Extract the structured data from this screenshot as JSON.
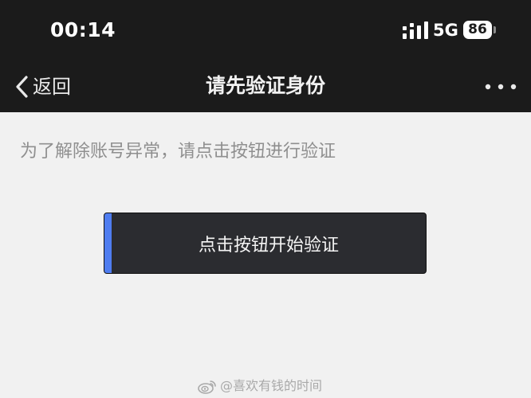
{
  "status_bar": {
    "time": "00:14",
    "network": "5G",
    "battery_level": "86",
    "icons": [
      "signal-icon",
      "battery-icon"
    ]
  },
  "nav": {
    "back_label": "返回",
    "back_icon": "chevron-left-icon",
    "title": "请先验证身份",
    "more_icon": "more-dots-icon"
  },
  "main": {
    "instruction": "为了解除账号异常，请点击按钮进行验证",
    "verify_button_label": "点击按钮开始验证"
  },
  "watermark": {
    "text": "@喜欢有钱的时间",
    "icon": "weibo-icon"
  },
  "colors": {
    "header_bg": "#1b1b1b",
    "page_bg": "#f1f1f1",
    "button_bg": "#2b2c30",
    "accent": "#4f7df0",
    "instruction_text": "#8f8f8f"
  }
}
